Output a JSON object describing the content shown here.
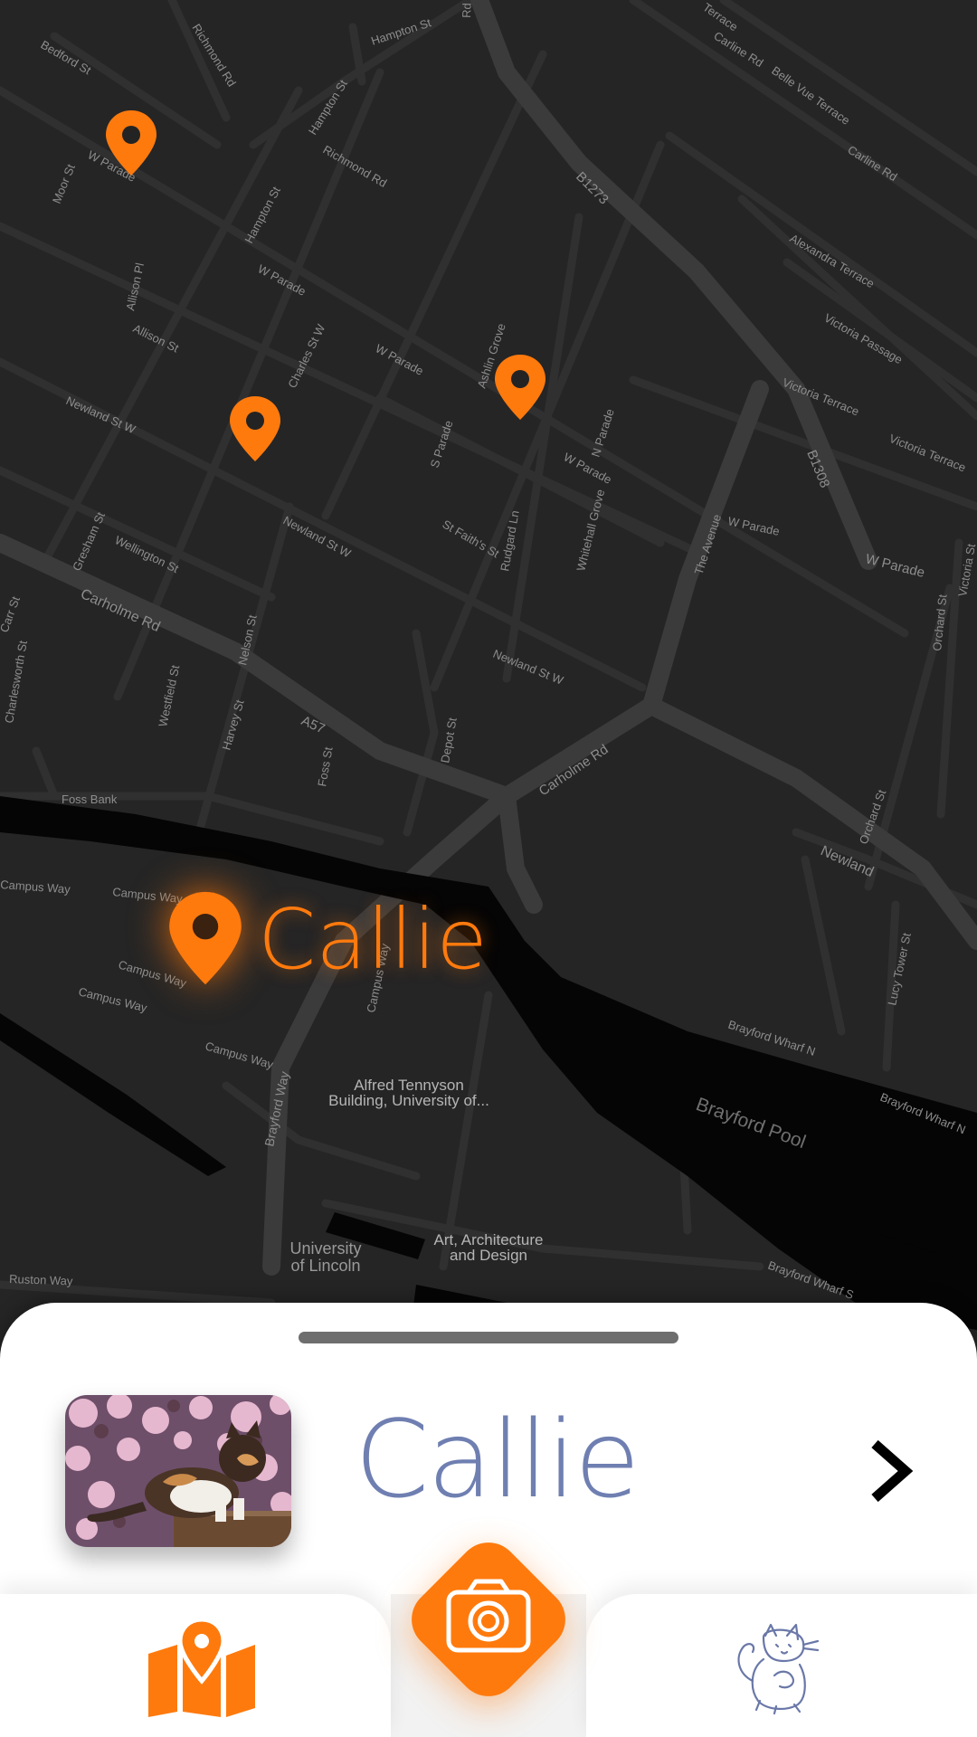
{
  "map": {
    "street_labels": {
      "bedford_st": "Bedford St",
      "richmond_rd_1": "Richmond Rd",
      "hampton_st_1": "Hampton St",
      "rd": "Rd",
      "terrace": "Terrace",
      "carline_rd_1": "Carline Rd",
      "belle_vue_terrace": "Belle Vue Terrace",
      "carline_rd_2": "Carline Rd",
      "hampton_st_2": "Hampton St",
      "richmond_rd_2": "Richmond Rd",
      "moor_st": "Moor St",
      "w_parade_1": "W Parade",
      "hampton_st_3": "Hampton St",
      "b1273": "B1273",
      "alexandra_terrace": "Alexandra Terrace",
      "allison_pl": "Allison Pl",
      "w_parade_2": "W Parade",
      "victoria_passage": "Victoria Passage",
      "charles_st_w": "Charles St W",
      "ashlin_grove": "Ashlin Grove",
      "allison_st": "Allison St",
      "w_parade_3": "W Parade",
      "victoria_terrace_1": "Victoria Terrace",
      "newland_st_w_1": "Newland St W",
      "s_parade": "S Parade",
      "n_parade": "N Parade",
      "b1308": "B1308",
      "victoria_terrace_2": "Victoria Terrace",
      "w_parade_4": "W Parade",
      "w_parade_5": "W Parade",
      "st_faiths_st": "St Faith's St",
      "rudgard_ln": "Rudgard Ln",
      "whitehall_grove": "Whitehall Grove",
      "the_avenue": "The Avenue",
      "w_parade_6": "W Parade",
      "w_parade_7": "W Parade",
      "wellington_st": "Wellington St",
      "gresham_st": "Gresham St",
      "newland_st_w_2": "Newland St W",
      "victoria_st": "Victoria St",
      "carholme_rd_1": "Carholme Rd",
      "carr_st": "Carr St",
      "charlesworth_st": "Charlesworth St",
      "nelson_st": "Nelson St",
      "westfield_st": "Westfield St",
      "newland_st_w_3": "Newland St W",
      "orchard_st_1": "Orchard St",
      "harvey_st": "Harvey St",
      "a57": "A57",
      "depot_st": "Depot St",
      "carholme_rd_2": "Carholme Rd",
      "foss_bank": "Foss Bank",
      "foss_st": "Foss St",
      "orchard_st_2": "Orchard St",
      "newland": "Newland",
      "campus_way_1": "Campus Way",
      "campus_way_2": "Campus Way",
      "campus_way_3": "Campus Way",
      "campus_way_4": "Campus Way",
      "campus_way_5": "Campus Way",
      "campus_way_6": "Campus Way",
      "lucy_tower_st": "Lucy Tower St",
      "brayford_wharf_n_1": "Brayford Wharf N",
      "brayford_wharf_n_2": "Brayford Wharf N",
      "brayford_way": "Brayford Way",
      "brayford_wharf_s": "Brayford Wharf S",
      "ruston_way": "Ruston Way"
    },
    "places": {
      "brayford_pool": "Brayford Pool",
      "alfred_tennyson_line1": "Alfred Tennyson",
      "alfred_tennyson_line2": "Building, University of...",
      "art_arch_line1": "Art, Architecture",
      "art_arch_line2": "and Design",
      "uni_line1": "University",
      "uni_line2": "of Lincoln"
    },
    "selected_pin_label": "Callie",
    "accent_color": "#ff7a0d"
  },
  "sheet": {
    "cat_name": "Callie",
    "name_color": "#6f7fb1"
  },
  "nav": {
    "map_icon": "map-pin-icon",
    "camera_icon": "camera-icon",
    "cats_icon": "cat-sketch-icon"
  }
}
